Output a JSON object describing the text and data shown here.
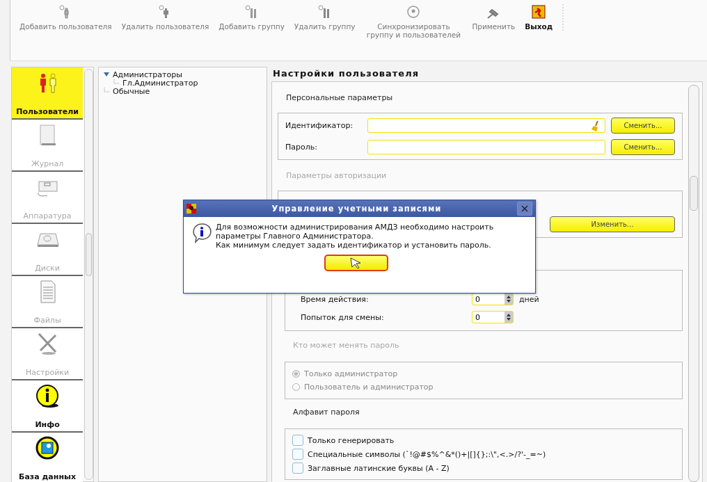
{
  "toolbar": [
    {
      "label": "Добавить пользователя",
      "emphasized": false
    },
    {
      "label": "Удалить пользователя",
      "emphasized": false
    },
    {
      "label": "Добавить группу",
      "emphasized": false
    },
    {
      "label": "Удалить группу",
      "emphasized": false
    },
    {
      "label": "Синхронизировать группу и пользователей",
      "emphasized": false
    },
    {
      "label": "Применить",
      "emphasized": false
    },
    {
      "label": "Выход",
      "emphasized": true
    }
  ],
  "sidebar": {
    "items": [
      {
        "label": "Пользователи",
        "selected": true,
        "disabled": false
      },
      {
        "label": "Журнал",
        "selected": false,
        "disabled": true
      },
      {
        "label": "Аппаратура",
        "selected": false,
        "disabled": true
      },
      {
        "label": "Диски",
        "selected": false,
        "disabled": true
      },
      {
        "label": "Файлы",
        "selected": false,
        "disabled": true
      },
      {
        "label": "Настройки",
        "selected": false,
        "disabled": true
      },
      {
        "label": "Инфо",
        "selected": false,
        "disabled": false
      },
      {
        "label": "База данных",
        "selected": false,
        "disabled": false
      }
    ]
  },
  "tree": [
    {
      "label": "Администраторы",
      "expanded": true,
      "children": [
        {
          "label": "Гл.Администратор"
        }
      ]
    },
    {
      "label": "Обычные"
    }
  ],
  "settings": {
    "title": "Настройки пользователя",
    "personal": {
      "title": "Персональные параметры",
      "fields": [
        {
          "label": "Идентификатор:",
          "kind": "clearable",
          "button": "Сменить..."
        },
        {
          "label": "Пароль:",
          "kind": "plain",
          "button": "Сменить..."
        }
      ]
    },
    "auth": {
      "title": "Параметры авторизации",
      "disabled": true,
      "button": "Изменить..."
    },
    "policy": {
      "rows": [
        {
          "label": "Время действия:",
          "value": "0",
          "unit": "дней"
        },
        {
          "label": "Попыток для смены:",
          "value": "0"
        }
      ]
    },
    "who": {
      "title": "Кто может менять пароль",
      "disabled": true,
      "options": [
        {
          "label": "Только администратор",
          "selected": true
        },
        {
          "label": "Пользователь и администратор",
          "selected": false
        }
      ]
    },
    "alphabet": {
      "title": "Алфавит пароля",
      "options": [
        {
          "label": "Только генерировать",
          "checked": false
        },
        {
          "label": "Специальные символы (`!@#$%^&*()+|[]{};:\\\",<.>/?'-_=~)",
          "checked": false
        },
        {
          "label": "Заглавные латинские буквы (A - Z)",
          "checked": false
        }
      ]
    }
  },
  "dialog": {
    "title": "Управление учетными записями",
    "lines": [
      "Для возможности администрирования АМДЗ необходимо настроить",
      "параметры Главного Администратора.",
      "Как минимум следует задать идентификатор и установить пароль."
    ]
  }
}
